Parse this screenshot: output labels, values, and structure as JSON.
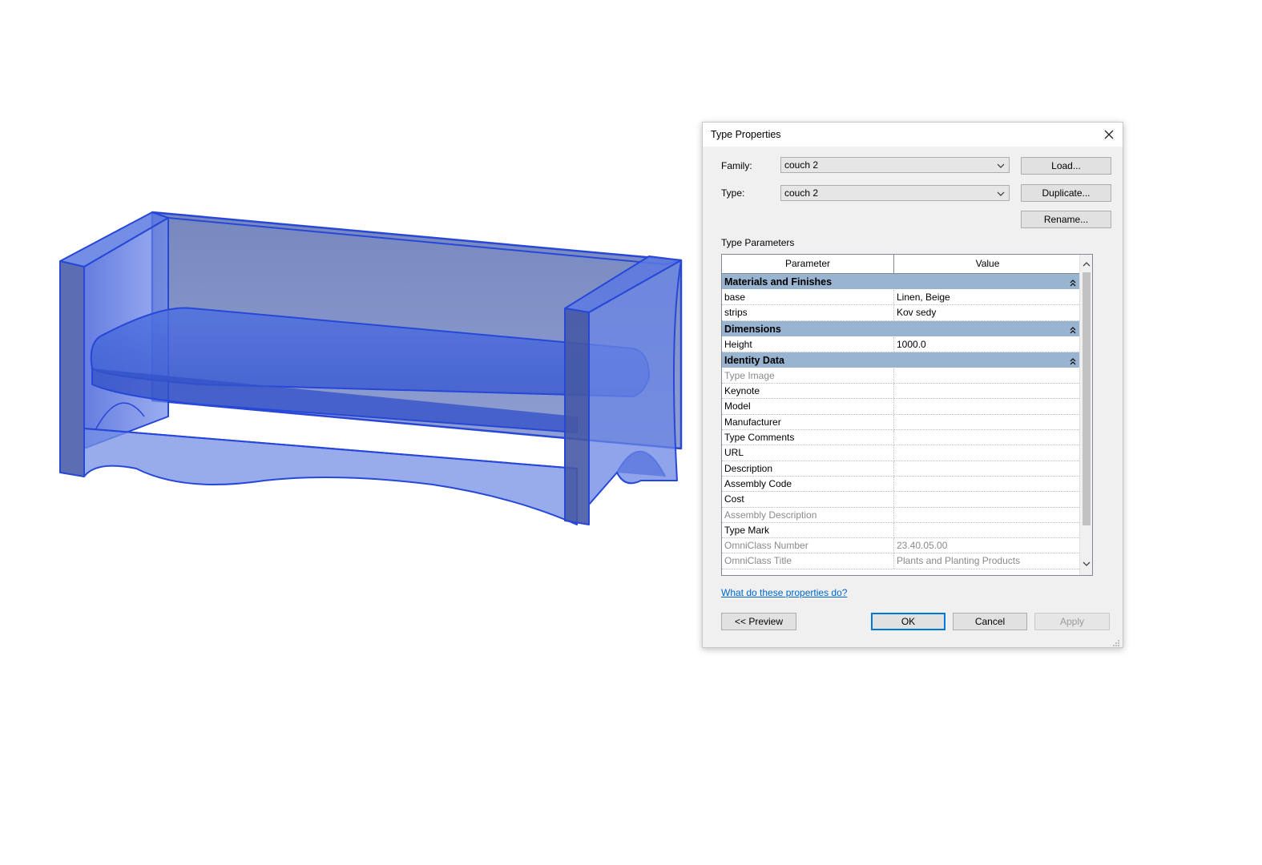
{
  "dialog": {
    "title": "Type Properties",
    "family_label": "Family:",
    "family_value": "couch 2",
    "type_label": "Type:",
    "type_value": "couch 2",
    "load_label": "Load...",
    "duplicate_label": "Duplicate...",
    "rename_label": "Rename...",
    "section_label": "Type Parameters",
    "columns": {
      "parameter": "Parameter",
      "value": "Value",
      "edit": "="
    },
    "groups": [
      {
        "title": "Materials and Finishes",
        "rows": [
          {
            "parameter": "base",
            "value": "Linen, Beige",
            "dim": false,
            "editable": true
          },
          {
            "parameter": "strips",
            "value": "Kov sedy",
            "dim": false,
            "editable": true
          }
        ]
      },
      {
        "title": "Dimensions",
        "rows": [
          {
            "parameter": "Height",
            "value": "1000.0",
            "dim": false,
            "editable": true
          }
        ]
      },
      {
        "title": "Identity Data",
        "rows": [
          {
            "parameter": "Type Image",
            "value": "",
            "dim": true,
            "editable": false
          },
          {
            "parameter": "Keynote",
            "value": "",
            "dim": false,
            "editable": true
          },
          {
            "parameter": "Model",
            "value": "",
            "dim": false,
            "editable": true
          },
          {
            "parameter": "Manufacturer",
            "value": "",
            "dim": false,
            "editable": true
          },
          {
            "parameter": "Type Comments",
            "value": "",
            "dim": false,
            "editable": true
          },
          {
            "parameter": "URL",
            "value": "",
            "dim": false,
            "editable": true
          },
          {
            "parameter": "Description",
            "value": "",
            "dim": false,
            "editable": true
          },
          {
            "parameter": "Assembly Code",
            "value": "",
            "dim": false,
            "editable": true
          },
          {
            "parameter": "Cost",
            "value": "",
            "dim": false,
            "editable": true
          },
          {
            "parameter": "Assembly Description",
            "value": "",
            "dim": true,
            "editable": false
          },
          {
            "parameter": "Type Mark",
            "value": "",
            "dim": false,
            "editable": false
          },
          {
            "parameter": "OmniClass Number",
            "value": "23.40.05.00",
            "dim": true,
            "editable": false
          },
          {
            "parameter": "OmniClass Title",
            "value": "Plants and Planting Products",
            "dim": true,
            "editable": false
          }
        ]
      }
    ],
    "help_link": "What do these properties do?",
    "preview_label": "<< Preview",
    "ok_label": "OK",
    "cancel_label": "Cancel",
    "apply_label": "Apply"
  },
  "colors": {
    "group_header": "#99b4d1",
    "model_blue": "#2f55d4",
    "model_fill": "#5a78d8",
    "link": "#0066cc",
    "primary_border": "#0078d7"
  },
  "icons": [
    "close-icon",
    "chevron-down-icon",
    "collapse-icon",
    "scroll-up-icon",
    "scroll-down-icon",
    "resize-grip-icon"
  ]
}
